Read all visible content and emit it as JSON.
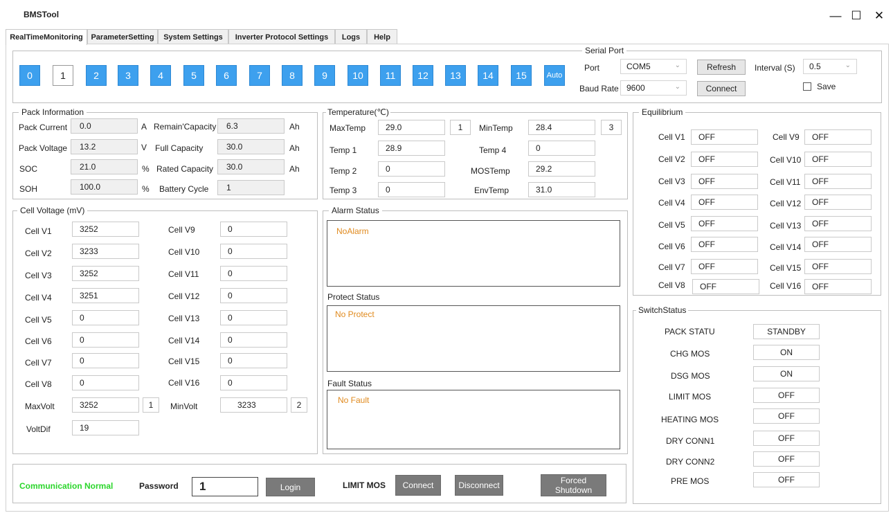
{
  "window": {
    "title": "BMSTool",
    "minimize": "—",
    "maximize": "☐",
    "close": "✕"
  },
  "tabs": [
    "RealTimeMonitoring",
    "ParameterSetting",
    "System Settings",
    "Inverter Protocol Settings",
    "Logs",
    "Help"
  ],
  "cells": [
    "0",
    "1",
    "2",
    "3",
    "4",
    "5",
    "6",
    "7",
    "8",
    "9",
    "10",
    "11",
    "12",
    "13",
    "14",
    "15",
    "Auto"
  ],
  "selected_cell": "1",
  "serial": {
    "title": "Serial Port",
    "port_label": "Port",
    "port_value": "COM5",
    "baud_label": "Baud Rate",
    "baud_value": "9600",
    "refresh": "Refresh",
    "connect": "Connect",
    "interval_label": "Interval (S)",
    "interval_value": "0.5",
    "save_label": "Save"
  },
  "pack": {
    "title": "Pack Information",
    "current_label": "Pack Current",
    "current": "0.0",
    "current_unit": "A",
    "voltage_label": "Pack Voltage",
    "voltage": "13.2",
    "voltage_unit": "V",
    "soc_label": "SOC",
    "soc": "21.0",
    "soc_unit": "%",
    "soh_label": "SOH",
    "soh": "100.0",
    "soh_unit": "%",
    "remain_label": "Remain'Capacity",
    "remain": "6.3",
    "remain_unit": "Ah",
    "full_label": "Full Capacity",
    "full": "30.0",
    "full_unit": "Ah",
    "rated_label": "Rated Capacity",
    "rated": "30.0",
    "rated_unit": "Ah",
    "cycle_label": "Battery Cycle",
    "cycle": "1"
  },
  "temperature": {
    "title": "Temperature(℃)",
    "maxtemp_label": "MaxTemp",
    "maxtemp": "29.0",
    "maxtemp_idx": "1",
    "mintemp_label": "MinTemp",
    "mintemp": "28.4",
    "mintemp_idx": "3",
    "t1_label": "Temp 1",
    "t1": "28.9",
    "t2_label": "Temp 2",
    "t2": "0",
    "t3_label": "Temp 3",
    "t3": "0",
    "t4_label": "Temp 4",
    "t4": "0",
    "mos_label": "MOSTemp",
    "mos": "29.2",
    "env_label": "EnvTemp",
    "env": "31.0"
  },
  "cellvoltage": {
    "title": "Cell Voltage (mV)",
    "left": [
      {
        "label": "Cell V1",
        "value": "3252"
      },
      {
        "label": "Cell V2",
        "value": "3233"
      },
      {
        "label": "Cell V3",
        "value": "3252"
      },
      {
        "label": "Cell V4",
        "value": "3251"
      },
      {
        "label": "Cell V5",
        "value": "0"
      },
      {
        "label": "Cell V6",
        "value": "0"
      },
      {
        "label": "Cell V7",
        "value": "0"
      },
      {
        "label": "Cell V8",
        "value": "0"
      }
    ],
    "right": [
      {
        "label": "Cell V9",
        "value": "0"
      },
      {
        "label": "Cell V10",
        "value": "0"
      },
      {
        "label": "Cell V11",
        "value": "0"
      },
      {
        "label": "Cell V12",
        "value": "0"
      },
      {
        "label": "Cell V13",
        "value": "0"
      },
      {
        "label": "Cell V14",
        "value": "0"
      },
      {
        "label": "Cell V15",
        "value": "0"
      },
      {
        "label": "Cell V16",
        "value": "0"
      }
    ],
    "maxvolt_label": "MaxVolt",
    "maxvolt": "3252",
    "maxvolt_idx": "1",
    "minvolt_label": "MinVolt",
    "minvolt": "3233",
    "minvolt_idx": "2",
    "voltdif_label": "VoltDif",
    "voltdif": "19"
  },
  "status": {
    "alarm_title": "Alarm Status",
    "alarm_text": "NoAlarm",
    "protect_title": "Protect Status",
    "protect_text": "No Protect",
    "fault_title": "Fault Status",
    "fault_text": "No Fault"
  },
  "equilibrium": {
    "title": "Equilibrium",
    "left": [
      {
        "label": "Cell V1",
        "value": "OFF"
      },
      {
        "label": "Cell V2",
        "value": "OFF"
      },
      {
        "label": "Cell V3",
        "value": "OFF"
      },
      {
        "label": "Cell V4",
        "value": "OFF"
      },
      {
        "label": "Cell V5",
        "value": "OFF"
      },
      {
        "label": "Cell V6",
        "value": "OFF"
      },
      {
        "label": "Cell V7",
        "value": "OFF"
      },
      {
        "label": "Cell V8",
        "value": "OFF"
      }
    ],
    "right": [
      {
        "label": "Cell V9",
        "value": "OFF"
      },
      {
        "label": "Cell V10",
        "value": "OFF"
      },
      {
        "label": "Cell V11",
        "value": "OFF"
      },
      {
        "label": "Cell V12",
        "value": "OFF"
      },
      {
        "label": "Cell V13",
        "value": "OFF"
      },
      {
        "label": "Cell V14",
        "value": "OFF"
      },
      {
        "label": "Cell V15",
        "value": "OFF"
      },
      {
        "label": "Cell V16",
        "value": "OFF"
      }
    ]
  },
  "switch": {
    "title": "SwitchStatus",
    "items": [
      {
        "label": "PACK STATU",
        "value": "STANDBY"
      },
      {
        "label": "CHG MOS",
        "value": "ON"
      },
      {
        "label": "DSG MOS",
        "value": "ON"
      },
      {
        "label": "LIMIT MOS",
        "value": "OFF"
      },
      {
        "label": "HEATING MOS",
        "value": "OFF"
      },
      {
        "label": "DRY CONN1",
        "value": "OFF"
      },
      {
        "label": "DRY CONN2",
        "value": "OFF"
      },
      {
        "label": "PRE MOS",
        "value": "OFF"
      }
    ]
  },
  "bottom": {
    "comm_status": "Communication Normal",
    "password_label": "Password",
    "password_value": "1",
    "login": "Login",
    "limit_mos_label": "LIMIT MOS",
    "connect": "Connect",
    "disconnect": "Disconnect",
    "forced_line1": "Forced",
    "forced_line2": "Shutdown"
  }
}
